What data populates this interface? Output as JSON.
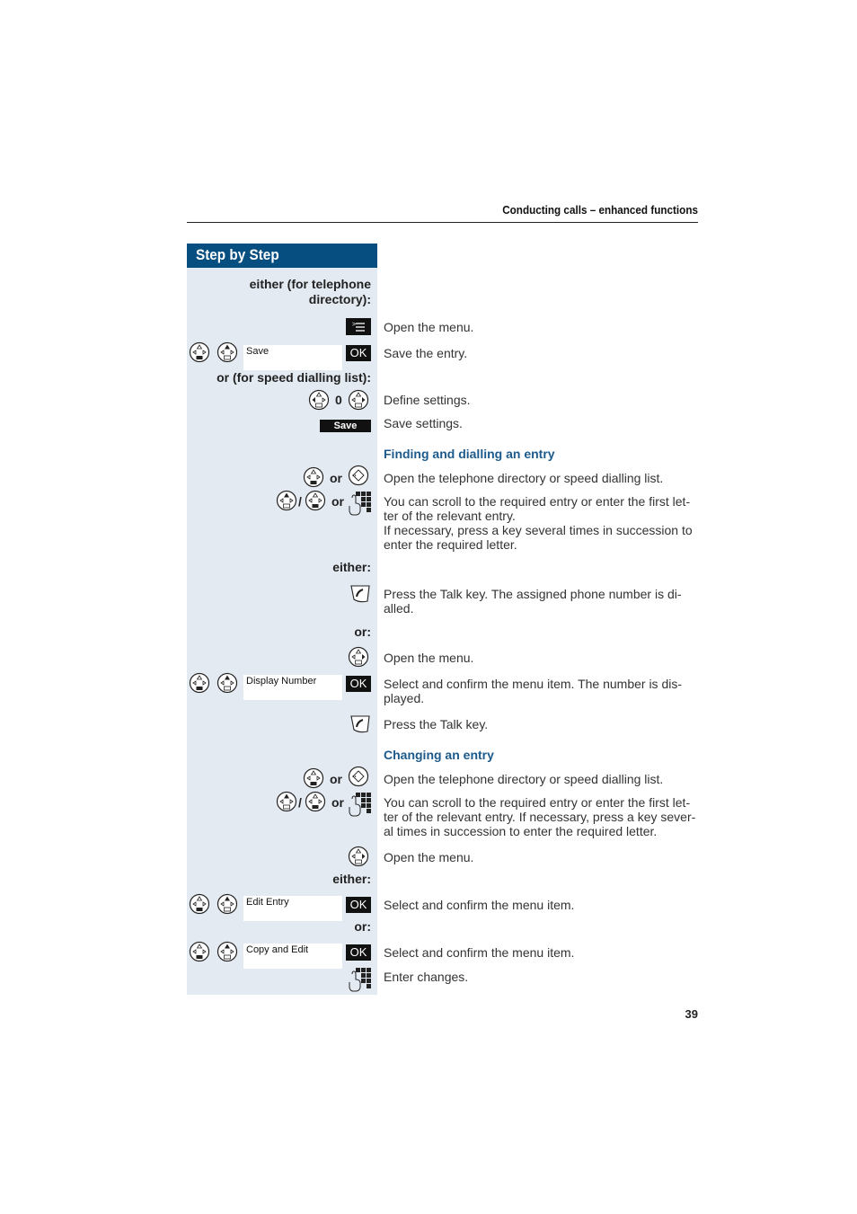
{
  "header": {
    "title": "Conducting calls – enhanced functions"
  },
  "sidebar": {
    "title": "Step by Step"
  },
  "labels": {
    "either_tel_dir": "either (for telephone directory):",
    "either_tel_dir_l1": "either (for telephone",
    "either_tel_dir_l2": "directory):",
    "or_speed": "or (for speed dialling list):",
    "either1": "either:",
    "or1": "or:",
    "either2": "either:",
    "or2": "or:",
    "or_word": "or",
    "slash": "/",
    "zero": "0"
  },
  "keys": {
    "ok": "OK",
    "save": "Save"
  },
  "menu_items": {
    "save": "Save",
    "display_number": "Display Number",
    "edit_entry": "Edit Entry",
    "copy_and_edit": "Copy and Edit"
  },
  "sections": {
    "finding": "Finding and dialling an entry",
    "changing": "Changing an entry"
  },
  "steps": {
    "open_menu_1": "Open the menu.",
    "save_entry": "Save the entry.",
    "define_settings": "Define settings.",
    "save_settings": "Save settings.",
    "open_dir_1": "Open the telephone directory or speed dialling list.",
    "scroll_1": "You can scroll to the required entry or enter the first let-ter of the relevant entry.",
    "scroll_1b": "If necessary, press a key several times in succession to enter the required letter.",
    "talk_1": "Press the Talk key. The assigned phone number is di-alled.",
    "open_menu_2": "Open the menu.",
    "display_confirm": "Select and confirm the menu item. The number is dis-played.",
    "talk_2": "Press the Talk key.",
    "open_dir_2": "Open the telephone directory or speed dialling list.",
    "scroll_2": "You can scroll to the required entry or enter the first let-ter of the relevant entry. If necessary, press a key sever-al times in succession to enter the required letter.",
    "open_menu_3": "Open the menu.",
    "edit_confirm": "Select and confirm the menu item.",
    "copy_confirm": "Select and confirm the menu item.",
    "enter_changes": "Enter changes."
  },
  "page_number": "39",
  "colors": {
    "sidebar_header": "#064e80",
    "sidebar_bg": "#e4eaf1",
    "section_heading": "#1d5a8c"
  }
}
